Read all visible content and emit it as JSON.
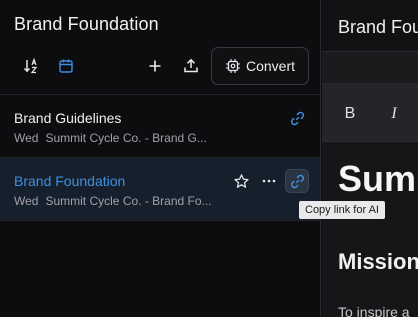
{
  "sidebar": {
    "title": "Brand Foundation",
    "toolbar": {
      "convert_label": "Convert"
    },
    "documents": [
      {
        "title": "Brand Guidelines",
        "day": "Wed",
        "source": "Summit Cycle Co. - Brand G..."
      },
      {
        "title": "Brand Foundation",
        "day": "Wed",
        "source": "Summit Cycle Co. - Brand Fo..."
      }
    ],
    "tooltip": "Copy link for AI"
  },
  "editor": {
    "title": "Brand Fou",
    "format": {
      "bold": "B",
      "italic": "I"
    },
    "heading1": "Sumr",
    "heading2": "Mission",
    "paragraph": "To inspire a"
  },
  "colors": {
    "accent": "#3f8fe0",
    "selected_row": "#16202c"
  }
}
